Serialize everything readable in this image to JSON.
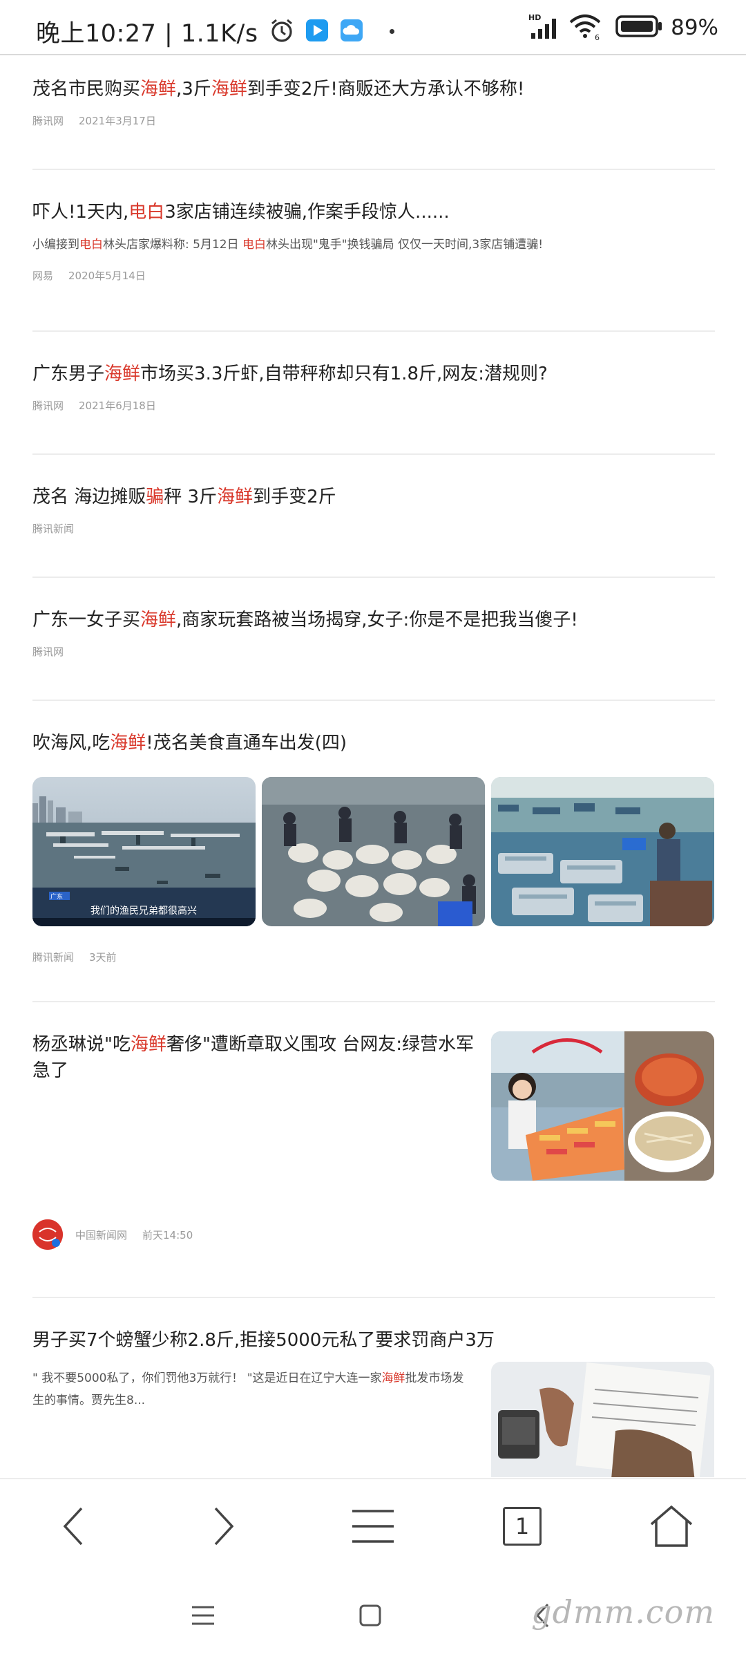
{
  "status_bar": {
    "time": "晚上10:27 | 1.1K/s",
    "battery": "89%",
    "icons": [
      "alarm-icon",
      "video-app-icon",
      "cloud-app-icon",
      "signal-icon",
      "wifi-icon",
      "battery-icon"
    ]
  },
  "articles": [
    {
      "title": [
        {
          "t": "茂名市民购买"
        },
        {
          "t": "海鲜",
          "hl": true
        },
        {
          "t": ",3斤"
        },
        {
          "t": "海鲜",
          "hl": true
        },
        {
          "t": "到手变2斤!商贩还大方承认不够称!"
        }
      ],
      "source": "腾讯网",
      "time": "2021年3月17日"
    },
    {
      "title": [
        {
          "t": "吓人!1天内,"
        },
        {
          "t": "电白",
          "hl": true
        },
        {
          "t": "3家店铺连续被骗,作案手段惊人......"
        }
      ],
      "summary": [
        {
          "t": "小编接到"
        },
        {
          "t": "电白",
          "hl": true
        },
        {
          "t": "林头店家爆料称: 5月12日 "
        },
        {
          "t": "电白",
          "hl": true
        },
        {
          "t": "林头出现\"鬼手\"换钱骗局 仅仅一天时间,3家店铺遭骗!"
        }
      ],
      "source": "网易",
      "time": "2020年5月14日"
    },
    {
      "title": [
        {
          "t": "广东男子"
        },
        {
          "t": "海鲜",
          "hl": true
        },
        {
          "t": "市场买3.3斤虾,自带秤称却只有1.8斤,网友:潜规则?"
        }
      ],
      "source": "腾讯网",
      "time": "2021年6月18日"
    },
    {
      "title": [
        {
          "t": "茂名 海边摊贩"
        },
        {
          "t": "骗",
          "hl": true
        },
        {
          "t": "秤 3斤"
        },
        {
          "t": "海鲜",
          "hl": true
        },
        {
          "t": "到手变2斤"
        }
      ],
      "source": "腾讯新闻",
      "time": ""
    },
    {
      "title": [
        {
          "t": "广东一女子买"
        },
        {
          "t": "海鲜",
          "hl": true
        },
        {
          "t": ",商家玩套路被当场揭穿,女子:你是不是把我当傻子!"
        }
      ],
      "source": "腾讯网",
      "time": ""
    },
    {
      "title": [
        {
          "t": "吹海风,吃"
        },
        {
          "t": "海鲜",
          "hl": true
        },
        {
          "t": "!茂名美食直通车出发(四)"
        }
      ],
      "source": "腾讯新闻",
      "time": "3天前",
      "thumb_caption_1": "我们的渔民兄弟都很高兴",
      "thumb_caption_2": "广东"
    },
    {
      "title": [
        {
          "t": "杨丞琳说\"吃"
        },
        {
          "t": "海鲜",
          "hl": true
        },
        {
          "t": "奢侈\"遭断章取义围攻 台网友:绿营水军急了"
        }
      ],
      "source": "中国新闻网",
      "time": "前天14:50"
    },
    {
      "title": [
        {
          "t": "男子买7个螃蟹少称2.8斤,拒接5000元私了要求罚商户3万"
        }
      ],
      "summary": [
        {
          "t": "\" 我不要5000私了，你们罚他3万就行！ \"这是近日在辽宁大连一家"
        },
        {
          "t": "海鲜",
          "hl": true
        },
        {
          "t": "批发市场发生的事情。贾先生8..."
        }
      ],
      "source": "",
      "time": ""
    }
  ],
  "nav": {
    "tab_count": "1",
    "buttons": [
      "back-icon",
      "forward-icon",
      "menu-icon",
      "tabs-icon",
      "home-icon"
    ]
  },
  "watermark": "gdmm.com"
}
